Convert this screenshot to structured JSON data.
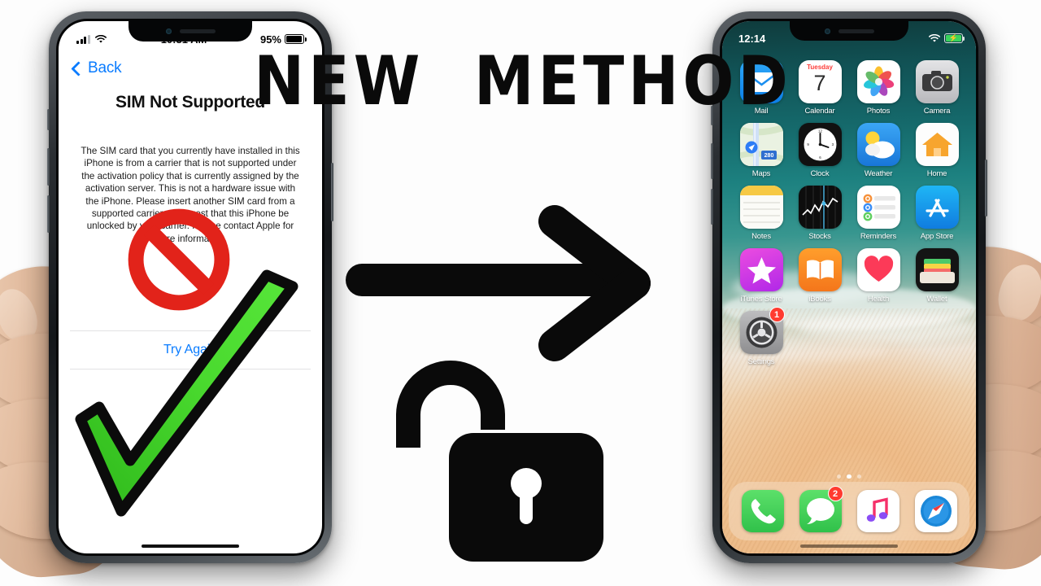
{
  "headline": {
    "text": "NEW  METHOD",
    "color": "#0a0a0a"
  },
  "center_graphics": {
    "arrow_icon": "arrow-right-icon",
    "lock_icon": "unlock-open-padlock-icon"
  },
  "left_phone": {
    "device": "iphone-x",
    "status_bar": {
      "signal_icon": "cellular-signal-icon",
      "wifi_icon": "wifi-icon",
      "time": "10:31 AM",
      "battery_percent": "95%",
      "battery_icon": "battery-icon"
    },
    "back_button": {
      "label": "Back",
      "icon": "chevron-left-icon",
      "color": "#0a7cff"
    },
    "title": "SIM Not Supported",
    "body": "The SIM card that you currently have installed in this iPhone is from a carrier that is not supported under the activation policy that is currently assigned by the activation server. This is not a hardware issue with the iPhone. Please insert another SIM card from a supported carrier or request that this iPhone be unlocked by your carrier. Please contact Apple for more information.",
    "try_again_label": "Try Again",
    "overlay_prohibition_icon": "prohibition-no-entry-icon",
    "overlay_prohibition_color": "#e2231a",
    "overlay_check_icon": "green-checkmark-icon",
    "overlay_check_color": "#3fcf27"
  },
  "right_phone": {
    "device": "iphone-x",
    "status_bar": {
      "time": "12:14",
      "wifi_icon": "wifi-icon",
      "battery_icon": "battery-charging-icon",
      "battery_color": "#3ad45c"
    },
    "apps": [
      {
        "label": "Mail",
        "icon": "mail-icon"
      },
      {
        "label": "Calendar",
        "icon": "calendar-icon",
        "day_name": "Tuesday",
        "day_number": "7"
      },
      {
        "label": "Photos",
        "icon": "photos-icon"
      },
      {
        "label": "Camera",
        "icon": "camera-icon"
      },
      {
        "label": "Maps",
        "icon": "maps-icon",
        "road_label": "280"
      },
      {
        "label": "Clock",
        "icon": "clock-icon"
      },
      {
        "label": "Weather",
        "icon": "weather-icon"
      },
      {
        "label": "Home",
        "icon": "home-icon"
      },
      {
        "label": "Notes",
        "icon": "notes-icon"
      },
      {
        "label": "Stocks",
        "icon": "stocks-icon"
      },
      {
        "label": "Reminders",
        "icon": "reminders-icon"
      },
      {
        "label": "App Store",
        "icon": "app-store-icon"
      },
      {
        "label": "iTunes Store",
        "icon": "itunes-store-icon"
      },
      {
        "label": "iBooks",
        "icon": "ibooks-icon"
      },
      {
        "label": "Health",
        "icon": "health-icon"
      },
      {
        "label": "Wallet",
        "icon": "wallet-icon"
      },
      {
        "label": "Settings",
        "icon": "settings-icon",
        "badge": "1"
      }
    ],
    "page_dots": {
      "count": 3,
      "active_index": 1
    },
    "dock": [
      {
        "label": "Phone",
        "icon": "phone-icon"
      },
      {
        "label": "Messages",
        "icon": "messages-icon",
        "badge": "2"
      },
      {
        "label": "Music",
        "icon": "music-icon"
      },
      {
        "label": "Safari",
        "icon": "safari-icon"
      }
    ]
  }
}
